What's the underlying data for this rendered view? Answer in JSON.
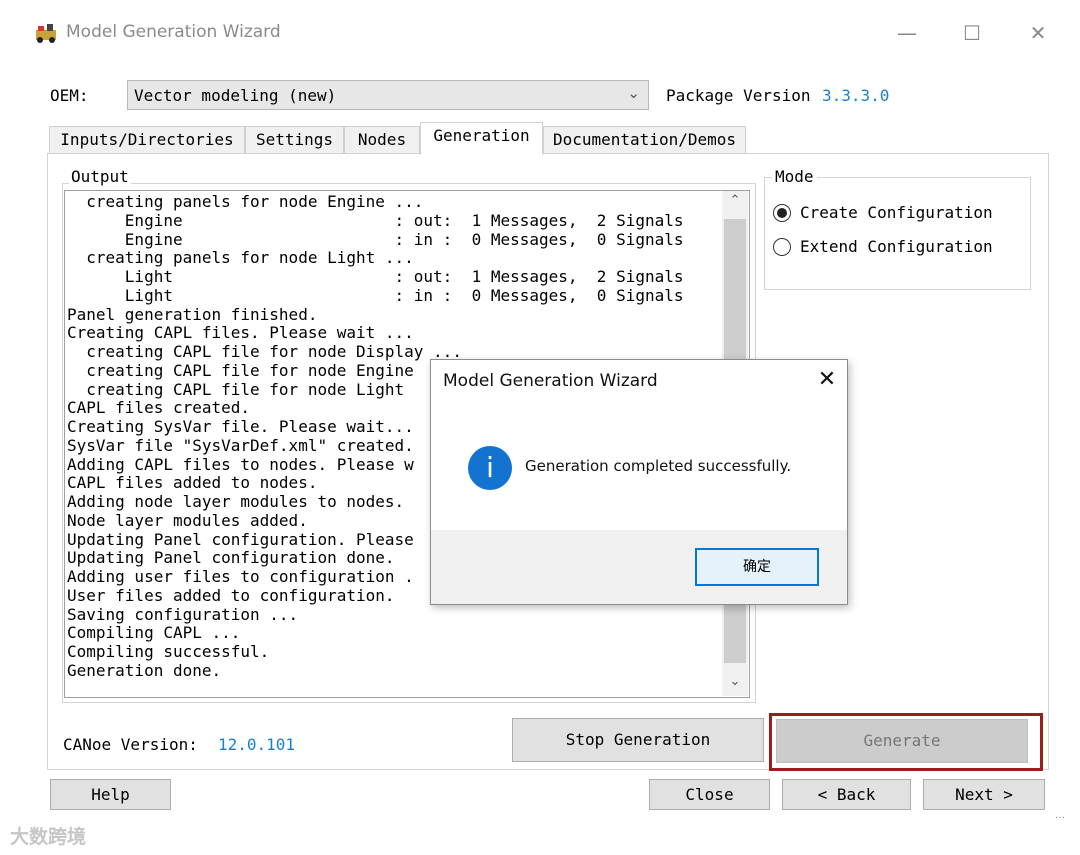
{
  "window": {
    "title": "Model Generation Wizard",
    "icon": "app-icon",
    "controls": [
      "—",
      "☐",
      "✕"
    ]
  },
  "oem": {
    "label": "OEM:",
    "value": "Vector modeling (new)"
  },
  "package": {
    "label": "Package Version",
    "value": "3.3.3.0"
  },
  "tabs": [
    {
      "label": "Inputs/Directories"
    },
    {
      "label": "Settings"
    },
    {
      "label": "Nodes"
    },
    {
      "label": "Generation",
      "active": true
    },
    {
      "label": "Documentation/Demos"
    }
  ],
  "output": {
    "label": "Output",
    "lines": [
      "  creating panels for node Engine ...",
      "      Engine                      : out:  1 Messages,  2 Signals",
      "      Engine                      : in :  0 Messages,  0 Signals",
      "  creating panels for node Light ...",
      "      Light                       : out:  1 Messages,  2 Signals",
      "      Light                       : in :  0 Messages,  0 Signals",
      "Panel generation finished.",
      "Creating CAPL files. Please wait ...",
      "  creating CAPL file for node Display ...",
      "  creating CAPL file for node Engine",
      "  creating CAPL file for node Light",
      "CAPL files created.",
      "Creating SysVar file. Please wait...",
      "SysVar file \"SysVarDef.xml\" created.",
      "Adding CAPL files to nodes. Please w",
      "CAPL files added to nodes.",
      "Adding node layer modules to nodes.",
      "Node layer modules added.",
      "Updating Panel configuration. Please",
      "Updating Panel configuration done.",
      "Adding user files to configuration .",
      "User files added to configuration.",
      "Saving configuration ...",
      "Compiling CAPL ...",
      "Compiling successful.",
      "Generation done."
    ]
  },
  "mode": {
    "label": "Mode",
    "options": [
      {
        "label": "Create Configuration",
        "checked": true
      },
      {
        "label": "Extend Configuration",
        "checked": false
      }
    ]
  },
  "canoe": {
    "label": "CANoe Version:",
    "value": "12.0.101"
  },
  "buttons": {
    "stop": "Stop Generation",
    "generate": "Generate",
    "help": "Help",
    "close": "Close",
    "back": "< Back",
    "next": "Next >"
  },
  "dialog": {
    "title": "Model Generation Wizard",
    "message": "Generation completed successfully.",
    "ok": "确定",
    "icon": "info-icon"
  },
  "watermark": "大数跨境",
  "colors": {
    "accent": "#1a7fd0",
    "highlight": "#9b1c1c",
    "info": "#1473d1"
  }
}
